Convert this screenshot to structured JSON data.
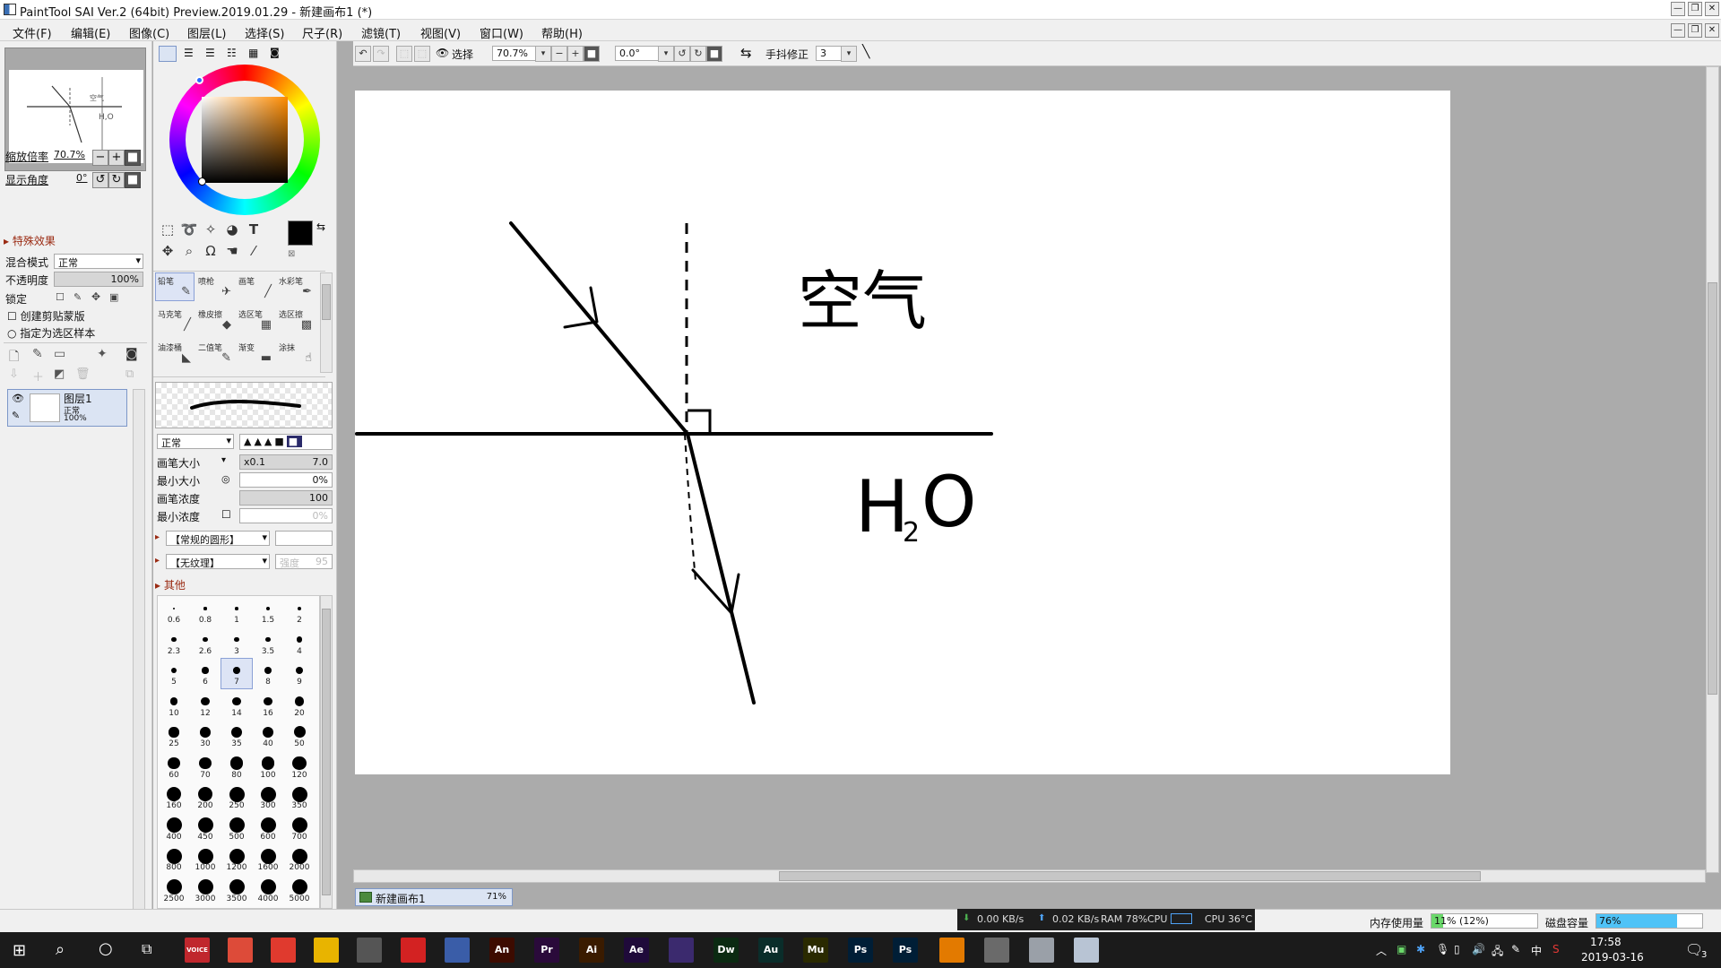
{
  "window": {
    "title": "PaintTool SAI Ver.2 (64bit) Preview.2019.01.29 - 新建画布1 (*)",
    "min": "—",
    "max": "❐",
    "close": "✕"
  },
  "menu": [
    "文件(F)",
    "编辑(E)",
    "图像(C)",
    "图层(L)",
    "选择(S)",
    "尺子(R)",
    "滤镜(T)",
    "视图(V)",
    "窗口(W)",
    "帮助(H)"
  ],
  "navigator": {
    "zoom_label": "缩放倍率",
    "zoom_value": "70.7%",
    "angle_label": "显示角度",
    "angle_value": "0°"
  },
  "effects": {
    "header": "特殊效果"
  },
  "layer_props": {
    "blend_label": "混合模式",
    "blend_value": "正常",
    "opacity_label": "不透明度",
    "opacity_value": "100%",
    "lock_label": "锁定",
    "clip_label": "创建剪贴蒙版",
    "sample_label": "指定为选区样本"
  },
  "layers": [
    {
      "name": "图层1",
      "mode": "正常",
      "opacity": "100%"
    }
  ],
  "brushes": [
    {
      "name": "铅笔",
      "glyph": "✎"
    },
    {
      "name": "喷枪",
      "glyph": "✈"
    },
    {
      "name": "画笔",
      "glyph": "╱"
    },
    {
      "name": "水彩笔",
      "glyph": "✒"
    },
    {
      "name": "马克笔",
      "glyph": "╱"
    },
    {
      "name": "橡皮擦",
      "glyph": "◆"
    },
    {
      "name": "选区笔",
      "glyph": "▦"
    },
    {
      "name": "选区擦",
      "glyph": "▩"
    },
    {
      "name": "油漆桶",
      "glyph": "◣"
    },
    {
      "name": "二值笔",
      "glyph": "✎"
    },
    {
      "name": "渐变",
      "glyph": "▬"
    },
    {
      "name": "涂抹",
      "glyph": "☝"
    }
  ],
  "brush_settings": {
    "mode_value": "正常",
    "size_label": "画笔大小",
    "size_mult": "x0.1",
    "size_value": "7.0",
    "minsize_label": "最小大小",
    "minsize_value": "0%",
    "density_label": "画笔浓度",
    "density_value": "100",
    "mindensity_label": "最小浓度",
    "mindensity_value": "0%",
    "shape_value": "【常规的圆形】",
    "texture_value": "【无纹理】",
    "texture_strength_label": "强度",
    "texture_strength_value": "95",
    "other_label": "其他"
  },
  "brush_sizes": [
    "0.6",
    "0.8",
    "1",
    "1.5",
    "2",
    "2.3",
    "2.6",
    "3",
    "3.5",
    "4",
    "5",
    "6",
    "7",
    "8",
    "9",
    "10",
    "12",
    "14",
    "16",
    "20",
    "25",
    "30",
    "35",
    "40",
    "50",
    "60",
    "70",
    "80",
    "100",
    "120",
    "160",
    "200",
    "250",
    "300",
    "350",
    "400",
    "450",
    "500",
    "600",
    "700",
    "800",
    "1000",
    "1200",
    "1600",
    "2000",
    "2500",
    "3000",
    "3500",
    "4000",
    "5000"
  ],
  "brush_size_selected": "7",
  "toolbar": {
    "select_label": "选择",
    "zoom_value": "70.7%",
    "angle_value": "0.0°",
    "stabilizer_label": "手抖修正",
    "stabilizer_value": "3"
  },
  "canvas_text": {
    "air": "空气",
    "water_h": "H",
    "water_sub": "2",
    "water_o": "O",
    "nav_water": "H,O"
  },
  "document_tab": {
    "name": "新建画布1",
    "zoom": "71%"
  },
  "status": {
    "net_down": "0.00 KB/s",
    "net_up": "0.02 KB/s",
    "ram": "RAM 78%",
    "cpu": "CPU",
    "cpu_temp": "CPU 36°C",
    "memory_label": "内存使用量",
    "memory_value": "11% (12%)",
    "memory_fraction": 0.11,
    "disk_label": "磁盘容量",
    "disk_value": "76%",
    "disk_fraction": 0.76
  },
  "taskbar": {
    "apps": [
      {
        "label": "VOICE",
        "color": "#c0272d"
      },
      {
        "label": "",
        "color": "#dd4b39"
      },
      {
        "label": "",
        "color": "#e03a2e"
      },
      {
        "label": "",
        "color": "#e8b400"
      },
      {
        "label": "",
        "color": "#555555"
      },
      {
        "label": "",
        "color": "#d32222"
      },
      {
        "label": "",
        "color": "#3a5da8"
      },
      {
        "label": "An",
        "color": "#3d0b00"
      },
      {
        "label": "Pr",
        "color": "#2a0a3a"
      },
      {
        "label": "Ai",
        "color": "#3a1b00"
      },
      {
        "label": "Ae",
        "color": "#1f0a3a"
      },
      {
        "label": "",
        "color": "#3b2a6e"
      },
      {
        "label": "Dw",
        "color": "#0b2a12"
      },
      {
        "label": "Au",
        "color": "#0a2d2a"
      },
      {
        "label": "Mu",
        "color": "#2a2a00"
      },
      {
        "label": "Ps",
        "color": "#001e36"
      },
      {
        "label": "Ps",
        "color": "#001e36"
      },
      {
        "label": "",
        "color": "#e37a00"
      },
      {
        "label": "",
        "color": "#6a6a6a"
      },
      {
        "label": "",
        "color": "#9aa0a8"
      },
      {
        "label": "",
        "color": "#b8c4d4"
      }
    ],
    "ime": "中",
    "time": "17:58",
    "date": "2019-03-16",
    "notify_count": "3"
  },
  "colors": {
    "accent": "#3a6fb5",
    "selection": "#dde4f5",
    "taskbar": "#1b1b1b",
    "disk_bar": "#4fc3f7",
    "mem_bar": "#6ad86a"
  }
}
